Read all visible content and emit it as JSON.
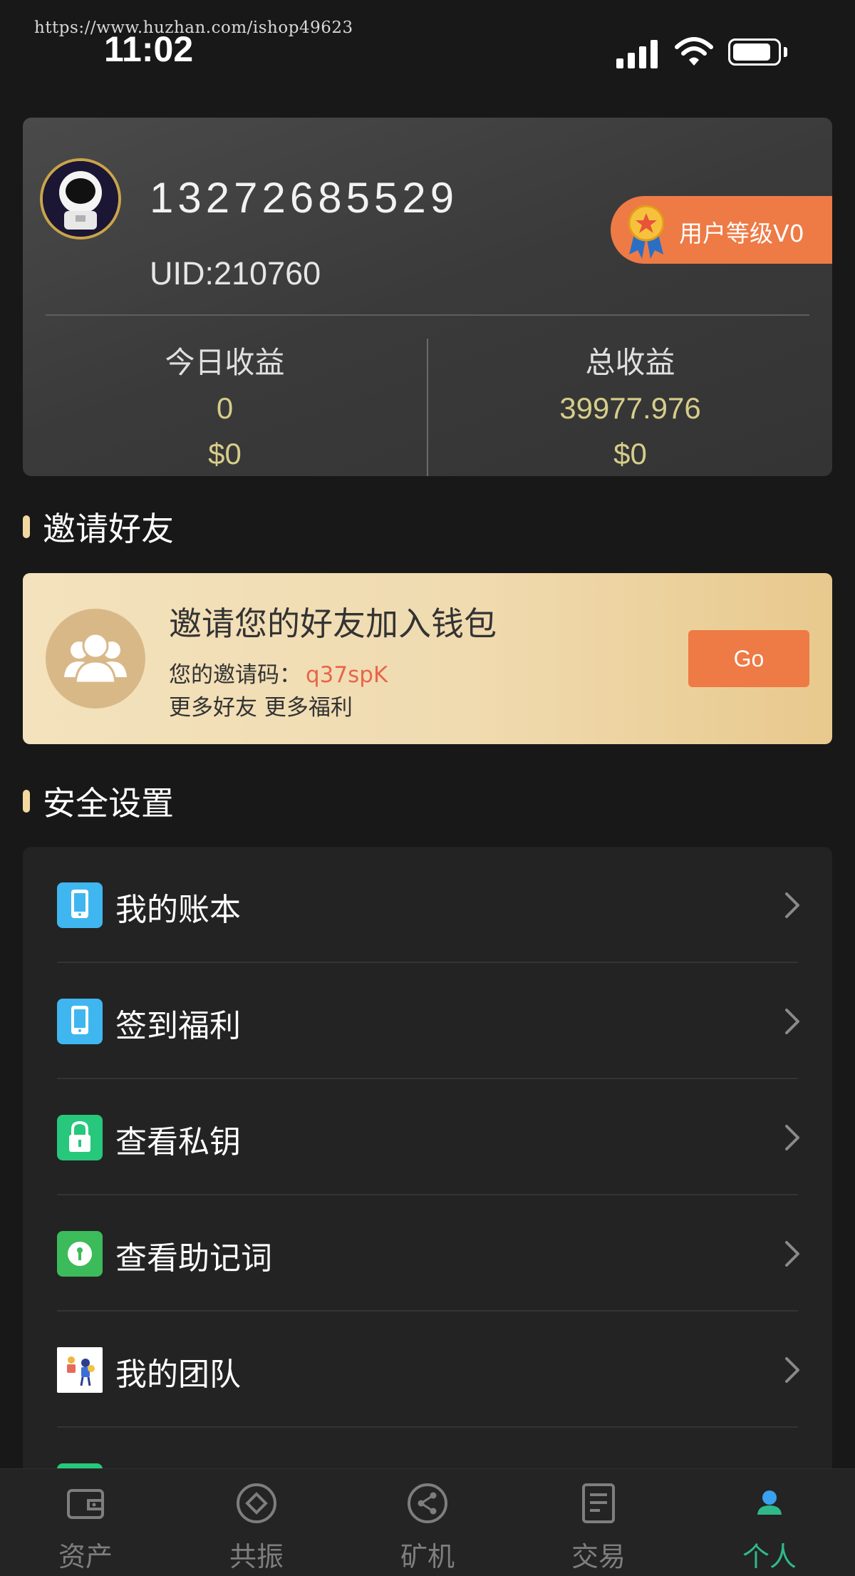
{
  "watermark": "https://www.huzhan.com/ishop49623",
  "status_bar": {
    "time": "11:02"
  },
  "profile": {
    "phone": "13272685529",
    "uid": "UID:210760",
    "level_badge": "用户等级V0",
    "today_earnings": {
      "title": "今日收益",
      "value": "0",
      "usd": "$0"
    },
    "total_earnings": {
      "title": "总收益",
      "value": "39977.976",
      "usd": "$0"
    }
  },
  "invite_section": {
    "header": "邀请好友",
    "title": "邀请您的好友加入钱包",
    "code_label": "您的邀请码：",
    "code": "q37spK",
    "subtitle": "更多好友 更多福利",
    "go_label": "Go"
  },
  "security_section": {
    "header": "安全设置",
    "items": [
      {
        "label": "我的账本",
        "icon": "phone-icon",
        "color": "#3fb6f0"
      },
      {
        "label": "签到福利",
        "icon": "phone-icon",
        "color": "#3fb6f0"
      },
      {
        "label": "查看私钥",
        "icon": "lock-icon",
        "color": "#27c77c"
      },
      {
        "label": "查看助记词",
        "icon": "keyhole-icon",
        "color": "#3cbb5a"
      },
      {
        "label": "我的团队",
        "icon": "team-illustration-icon",
        "color": "#ffffff"
      }
    ]
  },
  "bottom_nav": {
    "items": [
      {
        "label": "资产",
        "icon": "wallet-icon"
      },
      {
        "label": "共振",
        "icon": "diamond-circle-icon"
      },
      {
        "label": "矿机",
        "icon": "share-node-icon"
      },
      {
        "label": "交易",
        "icon": "document-icon"
      },
      {
        "label": "个人",
        "icon": "person-icon",
        "active": true
      }
    ],
    "active_color": "#2fb98a",
    "inactive_color": "#7e7e7e"
  },
  "colors": {
    "accent_orange": "#ee7a45",
    "gold_value": "#d6cd8a",
    "invite_code": "#e9654b"
  }
}
